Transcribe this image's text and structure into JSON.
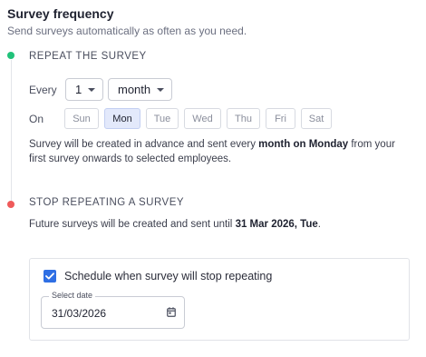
{
  "header": {
    "title": "Survey frequency",
    "subtitle": "Send surveys automatically as often as you need."
  },
  "repeat": {
    "heading": "REPEAT THE SURVEY",
    "every_label": "Every",
    "count_value": "1",
    "unit_value": "month",
    "on_label": "On",
    "days": [
      {
        "label": "Sun",
        "selected": false
      },
      {
        "label": "Mon",
        "selected": true
      },
      {
        "label": "Tue",
        "selected": false
      },
      {
        "label": "Wed",
        "selected": false
      },
      {
        "label": "Thu",
        "selected": false
      },
      {
        "label": "Fri",
        "selected": false
      },
      {
        "label": "Sat",
        "selected": false
      }
    ],
    "description": {
      "part1": "Survey will be created in advance and sent every ",
      "bold": "month on Monday",
      "part2": " from your first survey onwards to selected employees."
    }
  },
  "stop": {
    "heading": "STOP REPEATING A SURVEY",
    "text_part1": "Future surveys will be created and sent until ",
    "text_bold": "31 Mar 2026, Tue",
    "text_part2": ".",
    "checkbox_label": "Schedule when survey will stop repeating",
    "checkbox_checked": true,
    "date_label": "Select date",
    "date_value": "31/03/2026"
  },
  "colors": {
    "start_dot": "#21c27a",
    "stop_dot": "#ef5a5a",
    "checkbox": "#2f6fe4",
    "selected_day_bg": "#e3e9fb"
  }
}
